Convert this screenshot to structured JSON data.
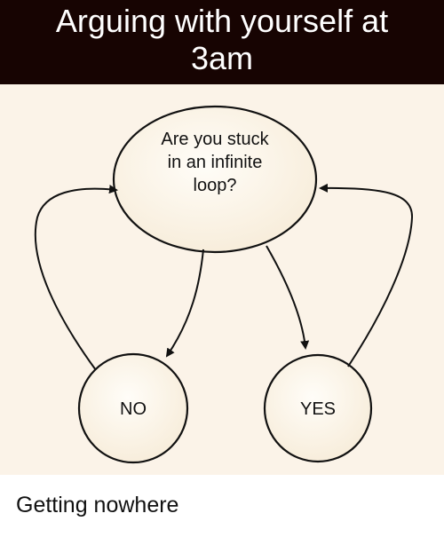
{
  "header": {
    "line1": "Arguing with yourself at",
    "line2": "3am"
  },
  "flowchart": {
    "question": {
      "line1": "Are you stuck",
      "line2": "in an infinite",
      "line3": "loop?"
    },
    "no_label": "NO",
    "yes_label": "YES"
  },
  "footer": {
    "caption": "Getting nowhere"
  }
}
